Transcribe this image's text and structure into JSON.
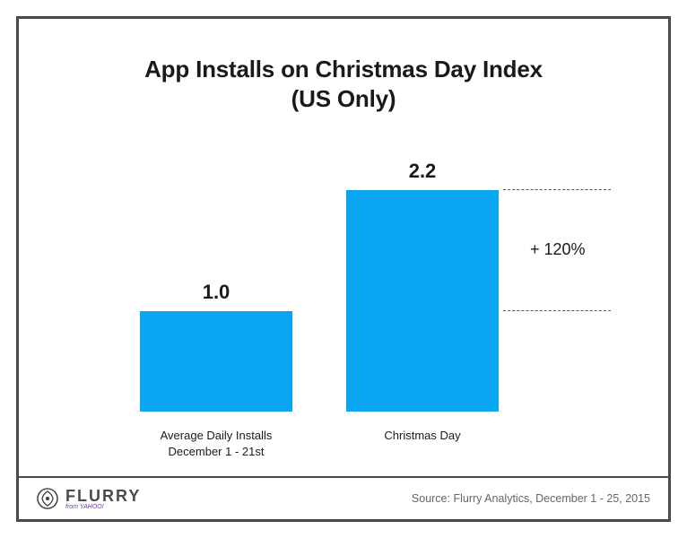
{
  "title_line1": "App Installs on Christmas Day Index",
  "title_line2": "(US Only)",
  "chart_data": {
    "type": "bar",
    "categories": [
      "Average Daily Installs\nDecember 1 - 21st",
      "Christmas Day"
    ],
    "values": [
      1.0,
      2.2
    ],
    "value_labels": [
      "1.0",
      "2.2"
    ],
    "title": "App Installs on Christmas Day Index (US Only)",
    "xlabel": "",
    "ylabel": "",
    "ylim": [
      0,
      2.4
    ],
    "bar_color": "#0ba6f2",
    "annotation": {
      "text": "+ 120%",
      "from_index": 0,
      "to_index": 1
    }
  },
  "brand": {
    "name": "FLURRY",
    "byline": "from YAHOO!"
  },
  "source": "Source: Flurry Analytics, December 1 - 25, 2015"
}
